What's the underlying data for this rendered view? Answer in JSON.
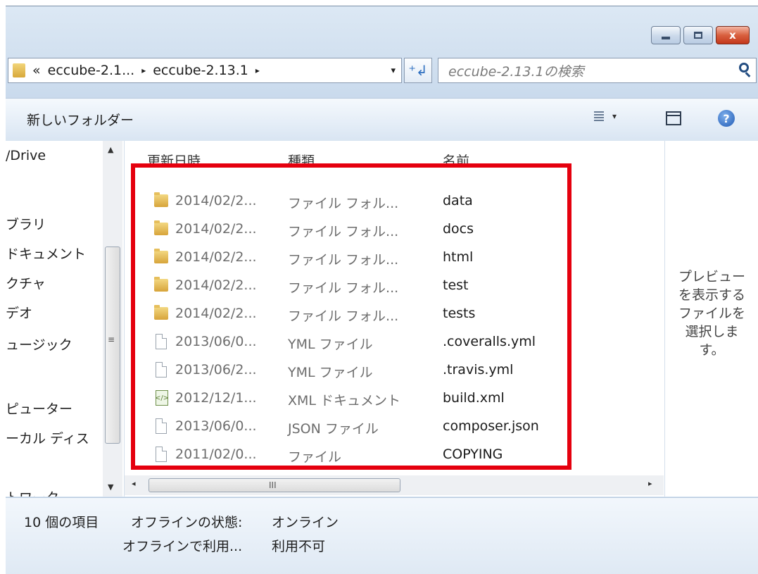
{
  "window": {
    "caption_buttons": [
      {
        "name": "minimize-button",
        "icon": "minimize-icon"
      },
      {
        "name": "maximize-button",
        "icon": "maximize-icon"
      },
      {
        "name": "close-button",
        "icon": "close-icon",
        "glyph": "x"
      }
    ]
  },
  "address": {
    "overflow": "«",
    "crumbs": [
      "eccube-2.1...",
      "eccube-2.13.1"
    ],
    "separator": "▸",
    "dropdown": "▾",
    "refresh": "⁺↲"
  },
  "search": {
    "placeholder": "eccube-2.13.1の検索"
  },
  "toolbar": {
    "new_folder_label": "新しいフォルダー",
    "view_dropdown": "▾",
    "help": "?"
  },
  "nav": {
    "items": [
      {
        "label": "/Drive"
      },
      {
        "label": "ブラリ"
      },
      {
        "label": "ドキュメント"
      },
      {
        "label": "クチャ"
      },
      {
        "label": "デオ"
      },
      {
        "label": "ュージック"
      },
      {
        "label": "ピューター"
      },
      {
        "label": "ーカル ディス"
      },
      {
        "label": "トワーク"
      }
    ],
    "scroll_grip": "≡",
    "scroll_up": "▲",
    "scroll_down": "▼"
  },
  "files": {
    "columns": {
      "date": "更新日時",
      "type": "種類",
      "name": "名前"
    },
    "rows": [
      {
        "icon": "folder-icon",
        "date": "2014/02/2...",
        "type": "ファイル フォル...",
        "name": "data"
      },
      {
        "icon": "folder-icon",
        "date": "2014/02/2...",
        "type": "ファイル フォル...",
        "name": "docs"
      },
      {
        "icon": "folder-icon",
        "date": "2014/02/2...",
        "type": "ファイル フォル...",
        "name": "html"
      },
      {
        "icon": "folder-icon",
        "date": "2014/02/2...",
        "type": "ファイル フォル...",
        "name": "test"
      },
      {
        "icon": "folder-icon",
        "date": "2014/02/2...",
        "type": "ファイル フォル...",
        "name": "tests"
      },
      {
        "icon": "file-icon",
        "date": "2013/06/0...",
        "type": "YML ファイル",
        "name": ".coveralls.yml"
      },
      {
        "icon": "file-icon",
        "date": "2013/06/2...",
        "type": "YML ファイル",
        "name": ".travis.yml"
      },
      {
        "icon": "xml-file-icon",
        "date": "2012/12/1...",
        "type": "XML ドキュメント",
        "name": "build.xml"
      },
      {
        "icon": "file-icon",
        "date": "2013/06/0...",
        "type": "JSON ファイル",
        "name": "composer.json"
      },
      {
        "icon": "file-icon",
        "date": "2011/02/0...",
        "type": "ファイル",
        "name": "COPYING"
      }
    ],
    "h_scroll": {
      "left": "◂",
      "grip": "III",
      "right": "▸"
    }
  },
  "preview": {
    "lines": [
      "プレビュー",
      "を表示する",
      "ファイルを",
      "選択しま",
      "す。"
    ]
  },
  "details": {
    "item_count": "10 個の項目",
    "offline_status_label": "オフラインの状態:",
    "offline_status_value": "オンライン",
    "offline_use_label": "オフラインで利用...",
    "offline_use_value": "利用不可"
  },
  "colors": {
    "highlight": "#e5000e",
    "chrome": "#d6e3f1"
  }
}
